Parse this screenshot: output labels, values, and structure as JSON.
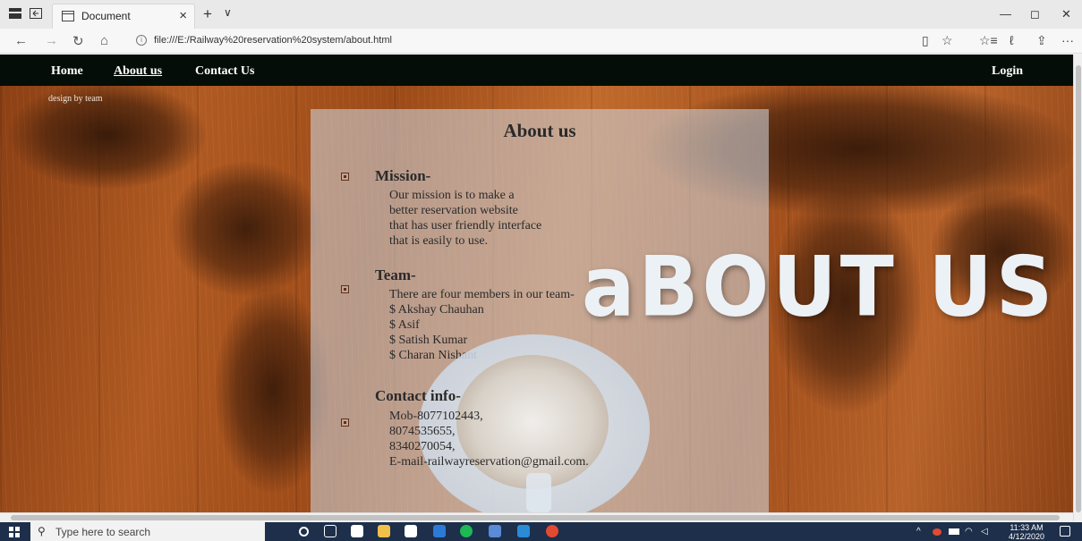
{
  "browser": {
    "tab_title": "Document",
    "tab_close": "×",
    "new_tab": "+",
    "tab_dropdown": "∨",
    "back": "←",
    "forward": "→",
    "refresh": "↻",
    "home": "⌂",
    "url": "file:///E:/Railway%20reservation%20system/about.html",
    "reading_view": "▯",
    "favorite": "☆",
    "favorites_bar": "☆≡",
    "pen": "ℓ",
    "share": "⇪",
    "more": "···",
    "minimize": "—",
    "restore": "◻",
    "close": "✕"
  },
  "nav": {
    "home": "Home",
    "about": "About us",
    "contact": "Contact Us",
    "login": "Login"
  },
  "credit": "design by team",
  "hero_text": "aBOUT US",
  "panel": {
    "title": "About us",
    "mission": {
      "heading": "Mission-",
      "lines": [
        "Our mission is to make a",
        "better reservation website",
        "that has user friendly interface",
        "that is easily to use."
      ]
    },
    "team": {
      "heading": "Team-",
      "lines": [
        "There are four members in our team-",
        "$ Akshay Chauhan",
        "$ Asif",
        "$ Satish Kumar",
        "$ Charan Nishant"
      ]
    },
    "contact": {
      "heading": "Contact info-",
      "lines": [
        "Mob-8077102443,",
        "8074535655,",
        "8340270054,",
        "E-mail-railwayreservation@gmail.com."
      ]
    }
  },
  "taskbar": {
    "search_placeholder": "Type here to search",
    "time": "11:33 AM",
    "date": "4/12/2020",
    "tray_arrow": "^"
  }
}
